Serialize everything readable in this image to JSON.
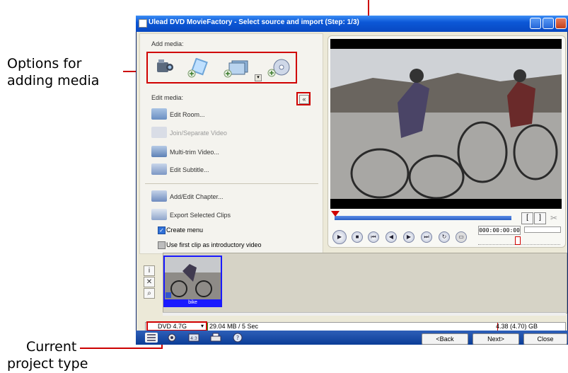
{
  "callouts": {
    "options": [
      "Options for",
      "adding media"
    ],
    "project_type": [
      "Current",
      "project type"
    ]
  },
  "window": {
    "title": "Ulead DVD MovieFactory - Select source and import (Step: 1/3)"
  },
  "left_panel": {
    "add_media_label": "Add media:",
    "add_media_icons": [
      "camcorder-icon",
      "video-file-icon",
      "image-file-icon",
      "disc-icon"
    ],
    "edit_media_label": "Edit media:",
    "edit_items": [
      {
        "label": "Edit Room...",
        "enabled": true
      },
      {
        "label": "Join/Separate Video",
        "enabled": false
      },
      {
        "label": "Multi-trim Video...",
        "enabled": true
      },
      {
        "label": "Edit Subtitle...",
        "enabled": true
      }
    ],
    "chapter_items": [
      {
        "label": "Add/Edit Chapter...",
        "enabled": true
      },
      {
        "label": "Export Selected Clips",
        "enabled": true
      }
    ],
    "create_menu": {
      "label": "Create menu",
      "checked": true
    },
    "intro_video": {
      "label": "Use first clip as introductory video",
      "checked": false
    }
  },
  "preview": {
    "timecode": "000:00:00:00",
    "mark_in": "[",
    "mark_out": "]"
  },
  "clips": [
    {
      "label": "bike"
    }
  ],
  "status": {
    "project_type": "DVD 4.7G",
    "used": "29.04 MB / 5 Sec",
    "capacity": "4.38 (4.70) GB"
  },
  "buttons": {
    "back": "<Back",
    "next": "Next>",
    "close": "Close"
  },
  "colors": {
    "accent_red": "#d00000",
    "title_blue": "#0c58d7",
    "clip_label_blue": "#1a1aff"
  }
}
